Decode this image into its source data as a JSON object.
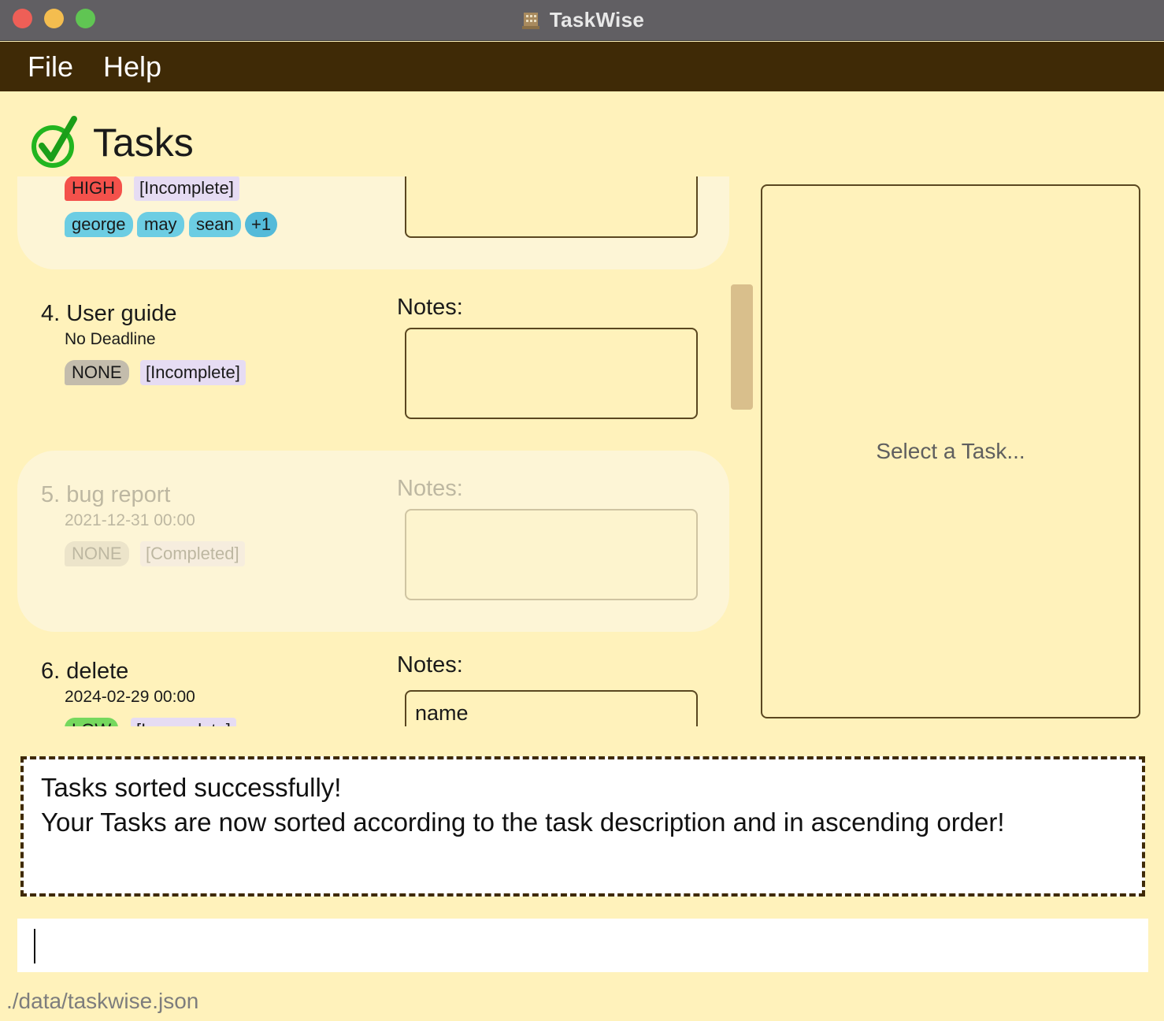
{
  "window": {
    "title": "TaskWise"
  },
  "menu": {
    "file": "File",
    "help": "Help"
  },
  "header": {
    "title": "Tasks"
  },
  "tasks": [
    {
      "priority": "HIGH",
      "status": "[Incomplete]",
      "tags": [
        "george",
        "may",
        "sean"
      ],
      "more_tags": "+1"
    },
    {
      "name": "4. User guide",
      "deadline": "No Deadline",
      "notes_label": "Notes:",
      "notes": "",
      "priority": "NONE",
      "status": "[Incomplete]"
    },
    {
      "name": "5. bug report",
      "deadline": "2021-12-31 00:00",
      "notes_label": "Notes:",
      "notes": "",
      "priority": "NONE",
      "status": "[Completed]"
    },
    {
      "name": "6. delete",
      "deadline": "2024-02-29 00:00",
      "notes_label": "Notes:",
      "notes": "name",
      "priority": "LOW",
      "status": "[Incomplete]"
    }
  ],
  "detail": {
    "placeholder": "Select a Task..."
  },
  "result": {
    "line1": "Tasks sorted successfully!",
    "line2": "Your Tasks are now sorted according to the task description and in ascending order!"
  },
  "command": {
    "value": ""
  },
  "status_bar": {
    "path": "./data/taskwise.json"
  },
  "colors": {
    "background": "#fff2bb",
    "menubar": "#3f2a06",
    "high": "#f4514b",
    "none": "#c3bcac",
    "low": "#76d85e",
    "tag": "#6ccde3"
  }
}
